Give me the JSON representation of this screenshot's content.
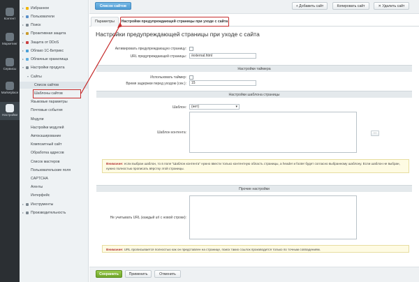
{
  "rail": [
    {
      "label": "Контент",
      "active": false
    },
    {
      "label": "Маркетинг",
      "active": false
    },
    {
      "label": "Сервисы",
      "active": false
    },
    {
      "label": "Marketplace",
      "active": false
    },
    {
      "label": "Настройки",
      "active": true
    }
  ],
  "sidebar": {
    "items": [
      {
        "label": "Избранное",
        "color": "#f0b400"
      },
      {
        "label": "Пользователи",
        "color": "#5a8fc8"
      },
      {
        "label": "Поиск",
        "color": "#7d8891"
      },
      {
        "label": "Проактивная защита",
        "color": "#c99b2e"
      },
      {
        "label": "Защита от DDoS",
        "color": "#c94040"
      },
      {
        "label": "Облако 1С-Битрикс",
        "color": "#4a9fd6"
      },
      {
        "label": "Облачные хранилища",
        "color": "#5eaee0"
      },
      {
        "label": "Настройки продукта",
        "color": "#7d8891"
      },
      {
        "label": "Сайты",
        "color": ""
      },
      {
        "label": "Список сайтов",
        "color": ""
      },
      {
        "label": "Шаблоны сайтов",
        "color": ""
      },
      {
        "label": "Языковые параметры",
        "color": ""
      },
      {
        "label": "Почтовые события",
        "color": ""
      },
      {
        "label": "Модули",
        "color": ""
      },
      {
        "label": "Настройки модулей",
        "color": ""
      },
      {
        "label": "Автокэширование",
        "color": ""
      },
      {
        "label": "Композитный сайт",
        "color": ""
      },
      {
        "label": "Обработка адресов",
        "color": ""
      },
      {
        "label": "Список мастеров",
        "color": ""
      },
      {
        "label": "Пользовательские поля",
        "color": ""
      },
      {
        "label": "CAPTCHA",
        "color": ""
      },
      {
        "label": "Агенты",
        "color": ""
      },
      {
        "label": "Интерфейс",
        "color": ""
      },
      {
        "label": "Инструменты",
        "color": "#7d8891"
      },
      {
        "label": "Производительность",
        "color": "#7d8891"
      }
    ]
  },
  "toolbar": {
    "list_button": "Список сайтов",
    "add_button": "+ Добавить сайт",
    "copy_button": "Копировать сайт",
    "delete_button": "✕ Удалить сайт"
  },
  "tabs": {
    "params": "Параметры",
    "warning": "Настройки предупреждающей страницы при уходе с сайта"
  },
  "page_title": "Настройки предупреждающей страницы при уходе с сайта",
  "form": {
    "activate_label": "Активировать предупреждающую страницу:",
    "url_label": "URL предупреждающей страницы:",
    "url_value": "/external.html",
    "timer_section": "Настройки таймера",
    "use_timer_label": "Использовать таймер:",
    "delay_label": "Время задержки перед уходом (сек.):",
    "delay_value": "15",
    "template_section": "Настройки шаблона страницы",
    "template_label": "Шаблон:",
    "template_value": "(нет)",
    "content_label": "Шаблон контента:",
    "dots": "...",
    "template_note_bold": "Внимание:",
    "template_note": " если выбран шаблон, то в поле \"Шаблон контента\" нужно ввести только контентную область страницы, а header и footer будет согласно выбранному шаблону. Если шаблон не выбран, нужно полностью прописать вёрстку этой страницы.",
    "other_section": "Прочие настройки",
    "ignore_label": "Не учитывать URL (каждый url с новой строки):",
    "url_note_bold": "Внимание:",
    "url_note": " URL прописывается полностью как он представлен на странице, поиск таких ссылок производится только по точным совпадениям."
  },
  "bottom": {
    "save": "Сохранить",
    "apply": "Применить",
    "cancel": "Отменить"
  },
  "colors": {
    "accent_red": "#c62c2c",
    "save_green": "#6fa62a",
    "list_blue": "#4f9bd3"
  }
}
